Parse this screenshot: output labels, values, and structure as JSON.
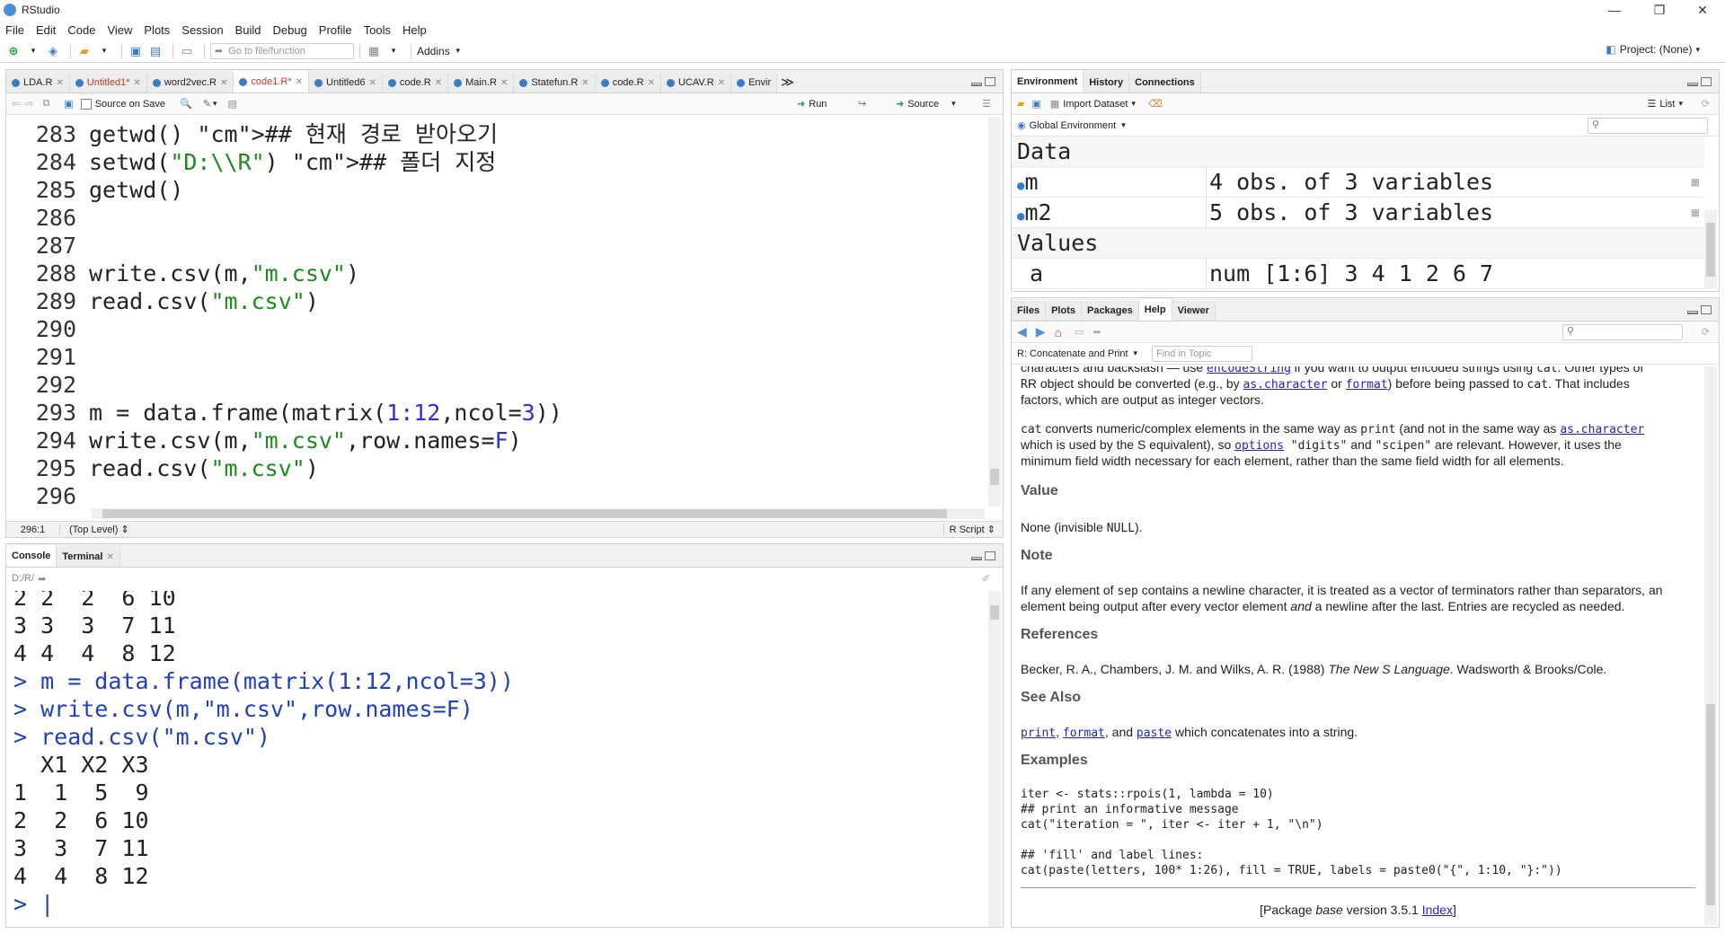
{
  "window": {
    "title": "RStudio",
    "controls": [
      "—",
      "❐",
      "✕"
    ]
  },
  "menu": [
    "File",
    "Edit",
    "Code",
    "View",
    "Plots",
    "Session",
    "Build",
    "Debug",
    "Profile",
    "Tools",
    "Help"
  ],
  "toolbar": {
    "goto_placeholder": "Go to file/function",
    "addins": "Addins",
    "project": "Project: (None)"
  },
  "editor": {
    "tabs": [
      {
        "label": "LDA.R",
        "active": false,
        "modified": false
      },
      {
        "label": "Untitled1*",
        "active": false,
        "modified": true
      },
      {
        "label": "word2vec.R",
        "active": false,
        "modified": false
      },
      {
        "label": "code1.R*",
        "active": true,
        "modified": true
      },
      {
        "label": "Untitled6",
        "active": false,
        "modified": false
      },
      {
        "label": "code.R",
        "active": false,
        "modified": false
      },
      {
        "label": "Main.R",
        "active": false,
        "modified": false
      },
      {
        "label": "Statefun.R",
        "active": false,
        "modified": false
      },
      {
        "label": "code.R",
        "active": false,
        "modified": false
      },
      {
        "label": "UCAV.R",
        "active": false,
        "modified": false
      },
      {
        "label": "Envir",
        "active": false,
        "modified": false
      }
    ],
    "source_on_save": "Source on Save",
    "run": "Run",
    "source": "Source",
    "lines": [
      {
        "n": "283",
        "code": "getwd() ## 현재 경로 받아오기"
      },
      {
        "n": "284",
        "code": "setwd(\"D:\\\\R\") ## 폴더 지정"
      },
      {
        "n": "285",
        "code": "getwd()"
      },
      {
        "n": "286",
        "code": ""
      },
      {
        "n": "287",
        "code": ""
      },
      {
        "n": "288",
        "code": "write.csv(m,\"m.csv\")"
      },
      {
        "n": "289",
        "code": "read.csv(\"m.csv\")"
      },
      {
        "n": "290",
        "code": ""
      },
      {
        "n": "291",
        "code": ""
      },
      {
        "n": "292",
        "code": ""
      },
      {
        "n": "293",
        "code": "m = data.frame(matrix(1:12,ncol=3))"
      },
      {
        "n": "294",
        "code": "write.csv(m,\"m.csv\",row.names=F)"
      },
      {
        "n": "295",
        "code": "read.csv(\"m.csv\")"
      },
      {
        "n": "296",
        "code": ""
      }
    ],
    "status": {
      "position": "296:1",
      "scope": "(Top Level)",
      "filetype": "R Script"
    }
  },
  "console": {
    "tabs": [
      "Console",
      "Terminal"
    ],
    "path": "D:/R/",
    "lines": [
      {
        "text": "2 2  2  6 10",
        "cmd": false
      },
      {
        "text": "3 3  3  7 11",
        "cmd": false
      },
      {
        "text": "4 4  4  8 12",
        "cmd": false
      },
      {
        "text": "> m = data.frame(matrix(1:12,ncol=3))",
        "cmd": true
      },
      {
        "text": "> write.csv(m,\"m.csv\",row.names=F)",
        "cmd": true
      },
      {
        "text": "> read.csv(\"m.csv\")",
        "cmd": true
      },
      {
        "text": "  X1 X2 X3",
        "cmd": false
      },
      {
        "text": "1  1  5  9",
        "cmd": false
      },
      {
        "text": "2  2  6 10",
        "cmd": false
      },
      {
        "text": "3  3  7 11",
        "cmd": false
      },
      {
        "text": "4  4  8 12",
        "cmd": false
      },
      {
        "text": "> |",
        "cmd": true
      }
    ]
  },
  "environment": {
    "tabs": [
      "Environment",
      "History",
      "Connections"
    ],
    "import_dataset": "Import Dataset",
    "list": "List",
    "scope": "Global Environment",
    "section_data": "Data",
    "section_values": "Values",
    "data_rows": [
      {
        "name": "m",
        "value": "4 obs. of 3 variables"
      },
      {
        "name": "m2",
        "value": "5 obs. of 3 variables"
      }
    ],
    "value_rows": [
      {
        "name": "a",
        "value": "num [1:6] 3 4 1 2 6 7"
      }
    ]
  },
  "help": {
    "tabs": [
      "Files",
      "Plots",
      "Packages",
      "Help",
      "Viewer"
    ],
    "topic": "R: Concatenate and Print",
    "find_placeholder": "Find in Topic",
    "p0_a": "characters and backslash — use ",
    "p0_link": "encodeString",
    "p0_b": " if you want to output encoded strings using ",
    "p0_code": "cat",
    "p0_c": ". Other types of",
    "p1_a": "R object should be converted (e.g., by ",
    "p1_link1": "as.character",
    "p1_b": " or ",
    "p1_link2": "format",
    "p1_c": ") before being passed to ",
    "p1_code": "cat",
    "p1_d": ". That includes",
    "p1_e": "factors, which are output as integer vectors.",
    "p2_code1": "cat",
    "p2_a": " converts numeric/complex elements in the same way as ",
    "p2_code2": "print",
    "p2_b": " (and not in the same way as ",
    "p2_link": "as.character",
    "p2_c": "which is used by the S equivalent), so ",
    "p2_link2": "options",
    "p2_code3": " \"digits\"",
    "p2_d": " and ",
    "p2_code4": "\"scipen\"",
    "p2_e": " are relevant. However, it uses the",
    "p2_f": "minimum field width necessary for each element, rather than the same field width for all elements.",
    "h_value": "Value",
    "value_a": "None (invisible ",
    "value_code": "NULL",
    "value_b": ").",
    "h_note": "Note",
    "note_a": "If any element of ",
    "note_code": "sep",
    "note_b": " contains a newline character, it is treated as a vector of terminators rather than separators, an",
    "note_c": "element being output after every vector element ",
    "note_em": "and",
    "note_d": " a newline after the last. Entries are recycled as needed.",
    "h_refs": "References",
    "refs_a": "Becker, R. A., Chambers, J. M. and Wilks, A. R. (1988) ",
    "refs_em": "The New S Language",
    "refs_b": ". Wadsworth & Brooks/Cole.",
    "h_seealso": "See Also",
    "see_link1": "print",
    "see_a": ", ",
    "see_link2": "format",
    "see_b": ", and ",
    "see_link3": "paste",
    "see_c": " which concatenates into a string.",
    "h_examples": "Examples",
    "ex1": "iter <- stats::rpois(1, lambda = 10)",
    "ex2": "## print an informative message",
    "ex3": "cat(\"iteration = \", iter <- iter + 1, \"\\n\")",
    "ex4": "## 'fill' and label lines:",
    "ex5": "cat(paste(letters, 100* 1:26), fill = TRUE, labels = paste0(\"{\", 1:10, \"}:\"))",
    "footer_a": "[Package ",
    "footer_em": "base",
    "footer_b": " version 3.5.1 ",
    "footer_link": "Index",
    "footer_c": "]"
  }
}
